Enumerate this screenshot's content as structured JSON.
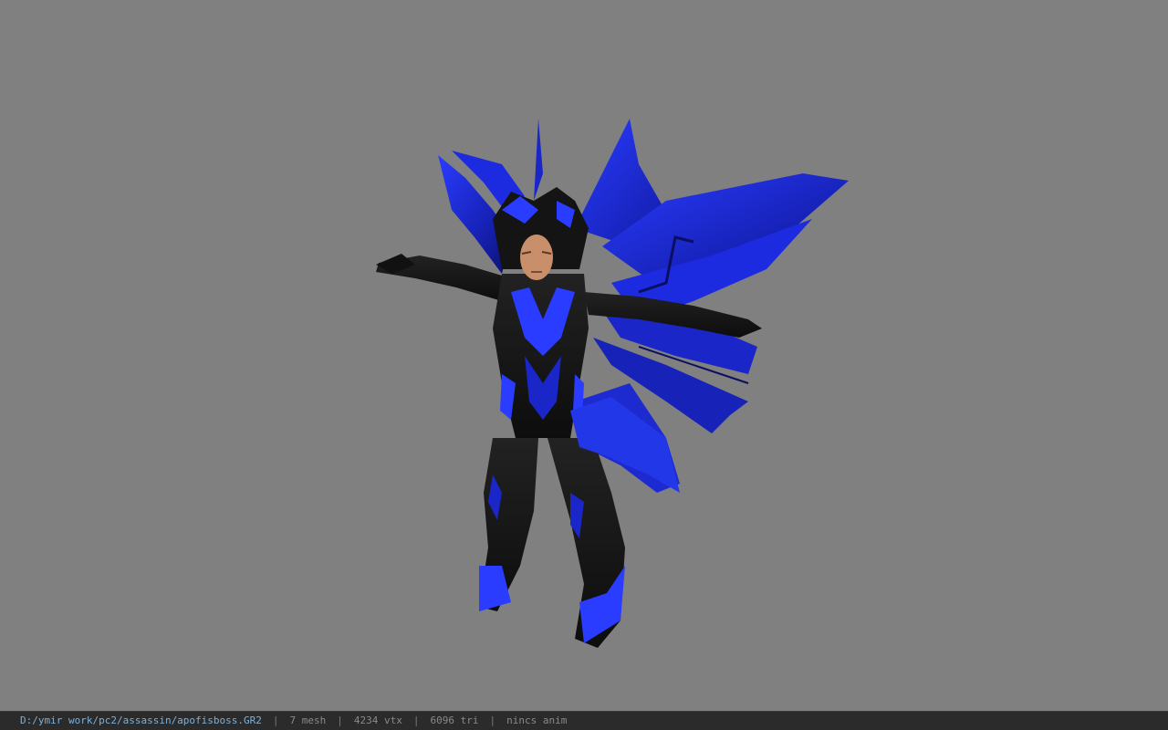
{
  "status_bar": {
    "file_path": "D:/ymir work/pc2/assassin/apofisboss.GR2",
    "separator": "|",
    "mesh_count": "7 mesh",
    "vertex_count": "4234 vtx",
    "triangle_count": "6096 tri",
    "animation": "nincs anim"
  },
  "viewport": {
    "background_color": "#808080",
    "model_primary_color": "#1a2bd6",
    "model_secondary_color": "#141414",
    "model_skin_color": "#c98f6b"
  }
}
